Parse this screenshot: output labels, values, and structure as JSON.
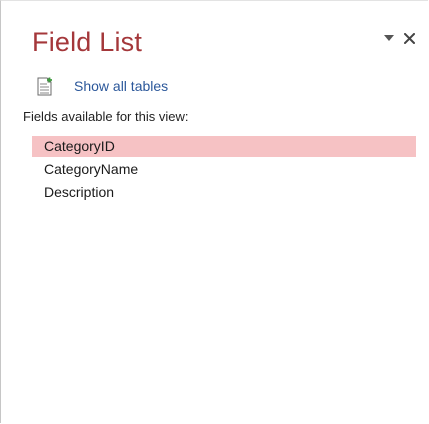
{
  "pane": {
    "title": "Field List",
    "menu_icon": "dropdown-arrow-icon",
    "close_icon": "close-icon"
  },
  "show_all": {
    "icon": "add-table-document-icon",
    "label": "Show all tables"
  },
  "fields_header": "Fields available for this view:",
  "fields": [
    {
      "label": "CategoryID",
      "selected": true
    },
    {
      "label": "CategoryName",
      "selected": false
    },
    {
      "label": "Description",
      "selected": false
    }
  ],
  "colors": {
    "title": "#a4373a",
    "link": "#2b579a",
    "selection": "#f6c2c4"
  }
}
